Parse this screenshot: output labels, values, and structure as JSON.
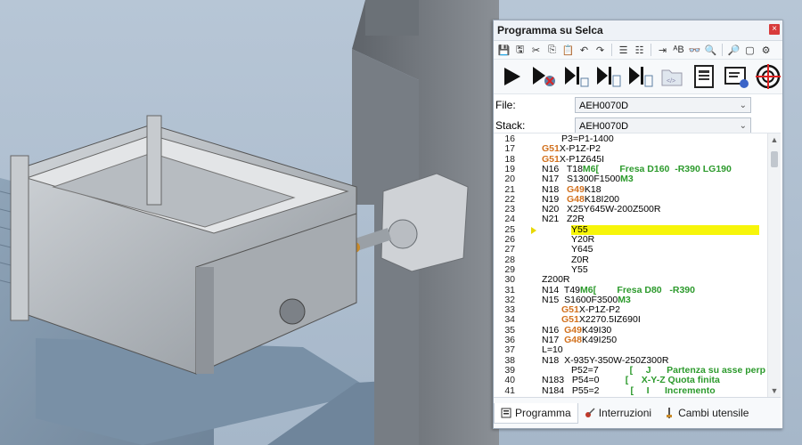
{
  "window": {
    "title": "Programma su Selca",
    "close": "×"
  },
  "toolbar_small": [
    {
      "name": "save-icon",
      "glyph": "💾"
    },
    {
      "name": "save-all-icon",
      "glyph": "🖫"
    },
    {
      "name": "cut-icon",
      "glyph": "✂"
    },
    {
      "name": "copy-icon",
      "glyph": "⎘"
    },
    {
      "name": "paste-icon",
      "glyph": "📋"
    },
    {
      "name": "undo-icon",
      "glyph": "↶"
    },
    {
      "name": "redo-icon",
      "glyph": "↷"
    },
    {
      "name": "breakpoint-list-icon",
      "glyph": "☰"
    },
    {
      "name": "bullet-list-icon",
      "glyph": "☷"
    },
    {
      "name": "indent-icon",
      "glyph": "⇥"
    },
    {
      "name": "sort-icon",
      "glyph": "ᴬB"
    },
    {
      "name": "find-icon",
      "glyph": "👓"
    },
    {
      "name": "find-next-icon",
      "glyph": "🔍"
    },
    {
      "name": "replace-icon",
      "glyph": "🔎"
    },
    {
      "name": "goto-icon",
      "glyph": "▢"
    },
    {
      "name": "settings-icon",
      "glyph": "⚙"
    }
  ],
  "fields": {
    "file_label": "File:",
    "file_value": "AEH0070D",
    "stack_label": "Stack:",
    "stack_value": "AEH0070D"
  },
  "code_lines": [
    {
      "n": "16",
      "indent": 2,
      "parts": [
        {
          "t": "P3=P1-1400"
        }
      ]
    },
    {
      "n": "17",
      "indent": 0,
      "parts": [
        {
          "t": "G51",
          "c": "orange"
        },
        {
          "t": "X-P1Z-P2"
        }
      ]
    },
    {
      "n": "18",
      "indent": 0,
      "parts": [
        {
          "t": "G51",
          "c": "orange"
        },
        {
          "t": "X-P1Z645I"
        }
      ]
    },
    {
      "n": "19",
      "indent": 0,
      "parts": [
        {
          "t": "N16   T18"
        },
        {
          "t": "M6",
          "c": "green"
        },
        {
          "t": "[",
          "c": "green"
        },
        {
          "t": "        Fresa D160  -R390 LG190",
          "c": "green"
        }
      ]
    },
    {
      "n": "20",
      "indent": 0,
      "parts": [
        {
          "t": "N17   S1300F1500"
        },
        {
          "t": "M3",
          "c": "green"
        }
      ]
    },
    {
      "n": "21",
      "indent": 0,
      "parts": [
        {
          "t": "N18   "
        },
        {
          "t": "G49",
          "c": "orange"
        },
        {
          "t": "K18"
        }
      ]
    },
    {
      "n": "22",
      "indent": 0,
      "parts": [
        {
          "t": "N19   "
        },
        {
          "t": "G48",
          "c": "orange"
        },
        {
          "t": "K18I200"
        }
      ]
    },
    {
      "n": "23",
      "indent": 0,
      "parts": [
        {
          "t": "N20   X25Y645W-200Z500R"
        }
      ]
    },
    {
      "n": "24",
      "indent": 0,
      "parts": [
        {
          "t": "N21   Z2R"
        }
      ]
    },
    {
      "n": "25",
      "indent": 3,
      "highlight": true,
      "parts": [
        {
          "t": "Y55"
        }
      ]
    },
    {
      "n": "26",
      "indent": 3,
      "parts": [
        {
          "t": "Y20R"
        }
      ]
    },
    {
      "n": "27",
      "indent": 3,
      "parts": [
        {
          "t": "Y645"
        }
      ]
    },
    {
      "n": "28",
      "indent": 3,
      "parts": [
        {
          "t": "Z0R"
        }
      ]
    },
    {
      "n": "29",
      "indent": 3,
      "parts": [
        {
          "t": "Y55"
        }
      ]
    },
    {
      "n": "30",
      "indent": 0,
      "parts": [
        {
          "t": "Z200R"
        }
      ]
    },
    {
      "n": "31",
      "indent": 0,
      "parts": [
        {
          "t": "N14  T49"
        },
        {
          "t": "M6",
          "c": "green"
        },
        {
          "t": "[",
          "c": "green"
        },
        {
          "t": "        Fresa D80   -R390",
          "c": "green"
        }
      ]
    },
    {
      "n": "32",
      "indent": 0,
      "parts": [
        {
          "t": "N15  S1600F3500"
        },
        {
          "t": "M3",
          "c": "green"
        }
      ]
    },
    {
      "n": "33",
      "indent": 2,
      "parts": [
        {
          "t": "G51",
          "c": "orange"
        },
        {
          "t": "X-P1Z-P2"
        }
      ]
    },
    {
      "n": "34",
      "indent": 2,
      "parts": [
        {
          "t": "G51",
          "c": "orange"
        },
        {
          "t": "X2270.5IZ690I"
        }
      ]
    },
    {
      "n": "35",
      "indent": 0,
      "parts": [
        {
          "t": "N16  "
        },
        {
          "t": "G49",
          "c": "orange"
        },
        {
          "t": "K49I30"
        }
      ]
    },
    {
      "n": "36",
      "indent": 0,
      "parts": [
        {
          "t": "N17  "
        },
        {
          "t": "G48",
          "c": "orange"
        },
        {
          "t": "K49I250"
        }
      ]
    },
    {
      "n": "37",
      "indent": 0,
      "parts": [
        {
          "t": "L=10"
        }
      ]
    },
    {
      "n": "38",
      "indent": 0,
      "parts": [
        {
          "t": "N18  X-935Y-350W-250Z300R"
        }
      ]
    },
    {
      "n": "39",
      "indent": 3,
      "parts": [
        {
          "t": "P52=7            "
        },
        {
          "t": "[     J      Partenza su asse perp",
          "c": "green"
        }
      ]
    },
    {
      "n": "40",
      "indent": 0,
      "parts": [
        {
          "t": "N183   P54=0          "
        },
        {
          "t": "[     X-Y-Z Quota finita",
          "c": "green"
        }
      ]
    },
    {
      "n": "41",
      "indent": 0,
      "parts": [
        {
          "t": "N184   P55=2            "
        },
        {
          "t": "[     I      Incremento",
          "c": "green"
        }
      ]
    }
  ],
  "tabs": [
    {
      "label": "Programma",
      "icon": "program-icon",
      "active": true
    },
    {
      "label": "Interruzioni",
      "icon": "interrupt-icon",
      "active": false
    },
    {
      "label": "Cambi utensile",
      "icon": "tool-change-icon",
      "active": false
    }
  ],
  "colors": {
    "keyword_orange": "#d2711e",
    "keyword_green": "#2c9a2c",
    "highlight": "#f7f50a"
  }
}
